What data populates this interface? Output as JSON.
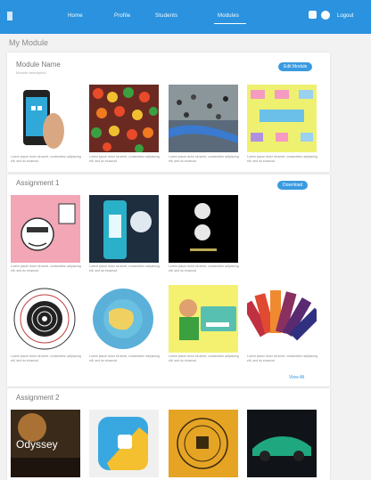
{
  "nav": {
    "items": [
      "Home",
      "Profile",
      "Students",
      "Modules"
    ],
    "active": "Modules",
    "logout_label": "Logout"
  },
  "page": {
    "title": "My Module"
  },
  "sections": [
    {
      "title": "Module Name",
      "subtitle": "Module description",
      "action_label": "Edit Module",
      "cards": [
        {
          "caption": "Lorem ipsum dolor sit amet, consectetur adipiscing elit, sed do eiusmod"
        },
        {
          "caption": "Lorem ipsum dolor sit amet, consectetur adipiscing elit, sed do eiusmod"
        },
        {
          "caption": "Lorem ipsum dolor sit amet, consectetur adipiscing elit, sed do eiusmod"
        },
        {
          "caption": "Lorem ipsum dolor sit amet, consectetur adipiscing elit, sed do eiusmod"
        }
      ]
    },
    {
      "title": "Assignment 1",
      "action_label": "Download",
      "cards": [
        {
          "caption": "Lorem ipsum dolor sit amet, consectetur adipiscing elit, sed do eiusmod"
        },
        {
          "caption": "Lorem ipsum dolor sit amet, consectetur adipiscing elit, sed do eiusmod"
        },
        {
          "caption": "Lorem ipsum dolor sit amet, consectetur adipiscing elit, sed do eiusmod"
        },
        {
          "caption": "Lorem ipsum dolor sit amet, consectetur adipiscing elit, sed do eiusmod"
        },
        {
          "caption": "Lorem ipsum dolor sit amet, consectetur adipiscing elit, sed do eiusmod"
        },
        {
          "caption": "Lorem ipsum dolor sit amet, consectetur adipiscing elit, sed do eiusmod"
        },
        {
          "caption": "Lorem ipsum dolor sit amet, consectetur adipiscing elit, sed do eiusmod"
        }
      ],
      "view_all_label": "View All"
    },
    {
      "title": "Assignment 2",
      "cards": [
        {
          "tile_text": "Odyssey"
        },
        {},
        {},
        {}
      ]
    }
  ],
  "colors": {
    "primary": "#2a92de",
    "accent": "#3a9ae0",
    "background": "#f2f2f2"
  }
}
